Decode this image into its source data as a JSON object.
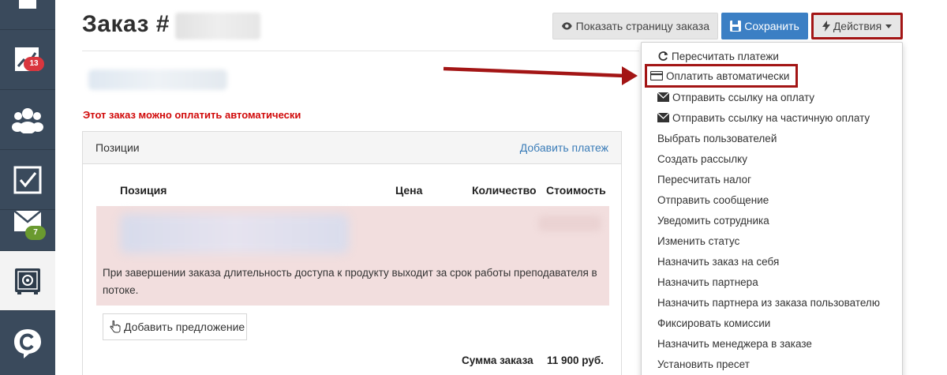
{
  "sidebar": {
    "items": [
      {
        "icon": "document-icon"
      },
      {
        "icon": "chart-icon",
        "badge": "13",
        "badge_color": "#d9363e"
      },
      {
        "icon": "users-icon"
      },
      {
        "icon": "checkbox-icon"
      },
      {
        "icon": "mail-icon",
        "badge": "7",
        "badge_color": "#6a9a2f"
      },
      {
        "icon": "safe-icon",
        "active": true
      },
      {
        "icon": "logo-icon"
      }
    ]
  },
  "header": {
    "title": "Заказ #",
    "show_page_label": "Показать страницу заказа",
    "save_label": "Сохранить",
    "actions_label": "Действия"
  },
  "notice": "Этот заказ можно оплатить автоматически",
  "panel": {
    "title": "Позиции",
    "add_payment_link": "Добавить платеж",
    "columns": [
      "Позиция",
      "Цена",
      "Количество",
      "Стоимость"
    ],
    "row_note": "При завершении заказа длительность доступа к продукту выходит за срок работы преподавателя в потоке.",
    "add_offer_label": "Добавить предложение",
    "sum_label": "Сумма заказа",
    "sum_value": "11 900 руб."
  },
  "actions_menu": [
    {
      "label": "Пересчитать платежи",
      "icon": "refresh-icon"
    },
    {
      "label": "Оплатить автоматически",
      "icon": "card-icon",
      "highlighted": true
    },
    {
      "label": "Отправить ссылку на оплату",
      "icon": "envelope-icon"
    },
    {
      "label": "Отправить ссылку на частичную оплату",
      "icon": "envelope-icon"
    },
    {
      "label": "Выбрать пользователей"
    },
    {
      "label": "Создать рассылку"
    },
    {
      "label": "Пересчитать налог"
    },
    {
      "label": "Отправить сообщение"
    },
    {
      "label": "Уведомить сотрудника"
    },
    {
      "label": "Изменить статус"
    },
    {
      "label": "Назначить заказ на себя"
    },
    {
      "label": "Назначить партнера"
    },
    {
      "label": "Назначить партнера из заказа пользователю"
    },
    {
      "label": "Фиксировать комиссии"
    },
    {
      "label": "Назначить менеджера в заказе"
    },
    {
      "label": "Установить пресет"
    }
  ],
  "colors": {
    "sidebar_bg": "#3a4a5c",
    "save_blue": "#3b7fc4",
    "notice_red": "#d10a0a",
    "highlight_red": "#a31515",
    "link_blue": "#3a7cb8",
    "row_pink": "#f2dede"
  }
}
